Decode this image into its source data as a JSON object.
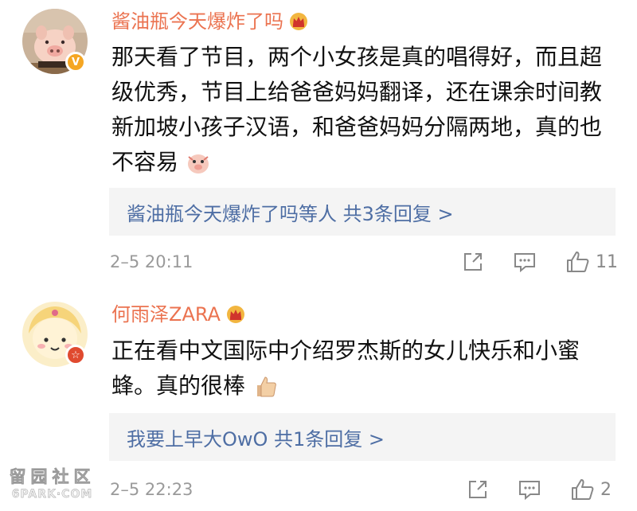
{
  "comments": [
    {
      "username": "酱油瓶今天爆炸了吗",
      "badge_icon": "vip-crown-icon",
      "avatar_badge": "verified-v-badge",
      "text": "那天看了节目，两个小女孩是真的唱得好，而且超级优秀，节目上给爸爸妈妈翻译，还在课余时间教新加坡小孩子汉语，和爸爸妈妈分隔两地，真的也不容易",
      "emoji": "cute-pig-emoji",
      "replies": "酱油瓶今天爆炸了吗等人 共3条回复 >",
      "timestamp": "2–5 20:11",
      "like_count": "11"
    },
    {
      "username": "何雨泽ZARA",
      "badge_icon": "vip-crown-icon",
      "avatar_badge": "star-badge",
      "text": "正在看中文国际中介绍罗杰斯的女儿快乐和小蜜蜂。真的很棒",
      "emoji": "thumbs-up-emoji",
      "replies": "我要上早大OwO 共1条回复 >",
      "timestamp": "2–5 22:23",
      "like_count": "2"
    }
  ],
  "watermark": {
    "chinese": "留园社区",
    "english": "6PARK·COM"
  },
  "colors": {
    "username": "#eb7350",
    "link": "#4e6ea4",
    "meta": "#9a9a9a",
    "reply_bg": "#f4f4f4"
  }
}
